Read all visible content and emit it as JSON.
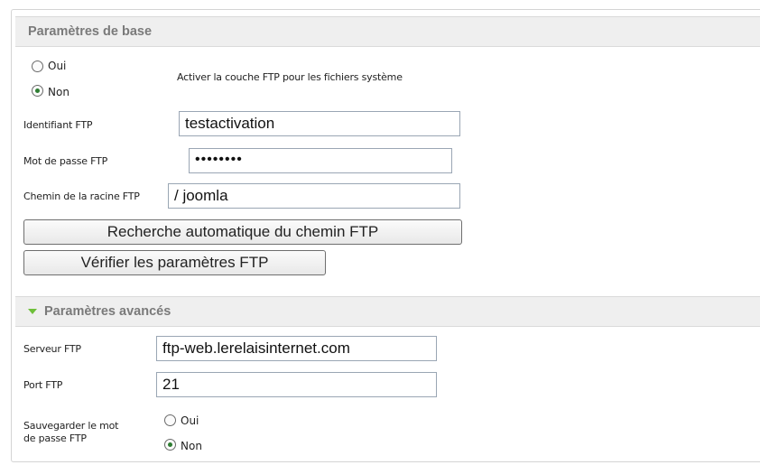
{
  "basic": {
    "title": "Paramètres de base",
    "ftp_layer": {
      "yes_label": "Oui",
      "no_label": "Non",
      "selected": "Non",
      "description": "Activer la couche FTP pour les fichiers système"
    },
    "ftp_user": {
      "label": "Identifiant FTP",
      "value": "testactivation"
    },
    "ftp_pass": {
      "label": "Mot de passe FTP",
      "value": "••••••••"
    },
    "ftp_root": {
      "label": "Chemin de la racine FTP",
      "value": "/ joomla"
    },
    "autofind_button": "Recherche automatique du chemin FTP",
    "verify_button": "Vérifier les paramètres FTP"
  },
  "advanced": {
    "title": "Paramètres avancés",
    "ftp_host": {
      "label": "Serveur FTP",
      "value": "ftp-web.lerelaisinternet.com"
    },
    "ftp_port": {
      "label": "Port FTP",
      "value": "21"
    },
    "save_pass": {
      "label_line1": "Sauvegarder le mot",
      "label_line2": "de passe FTP",
      "yes_label": "Oui",
      "no_label": "Non",
      "selected": "Non"
    }
  },
  "colors": {
    "header_bg": "#efefef",
    "header_text": "#7a7a7a",
    "accent_green": "#6ebf3a",
    "input_border": "#9aa6b4"
  }
}
